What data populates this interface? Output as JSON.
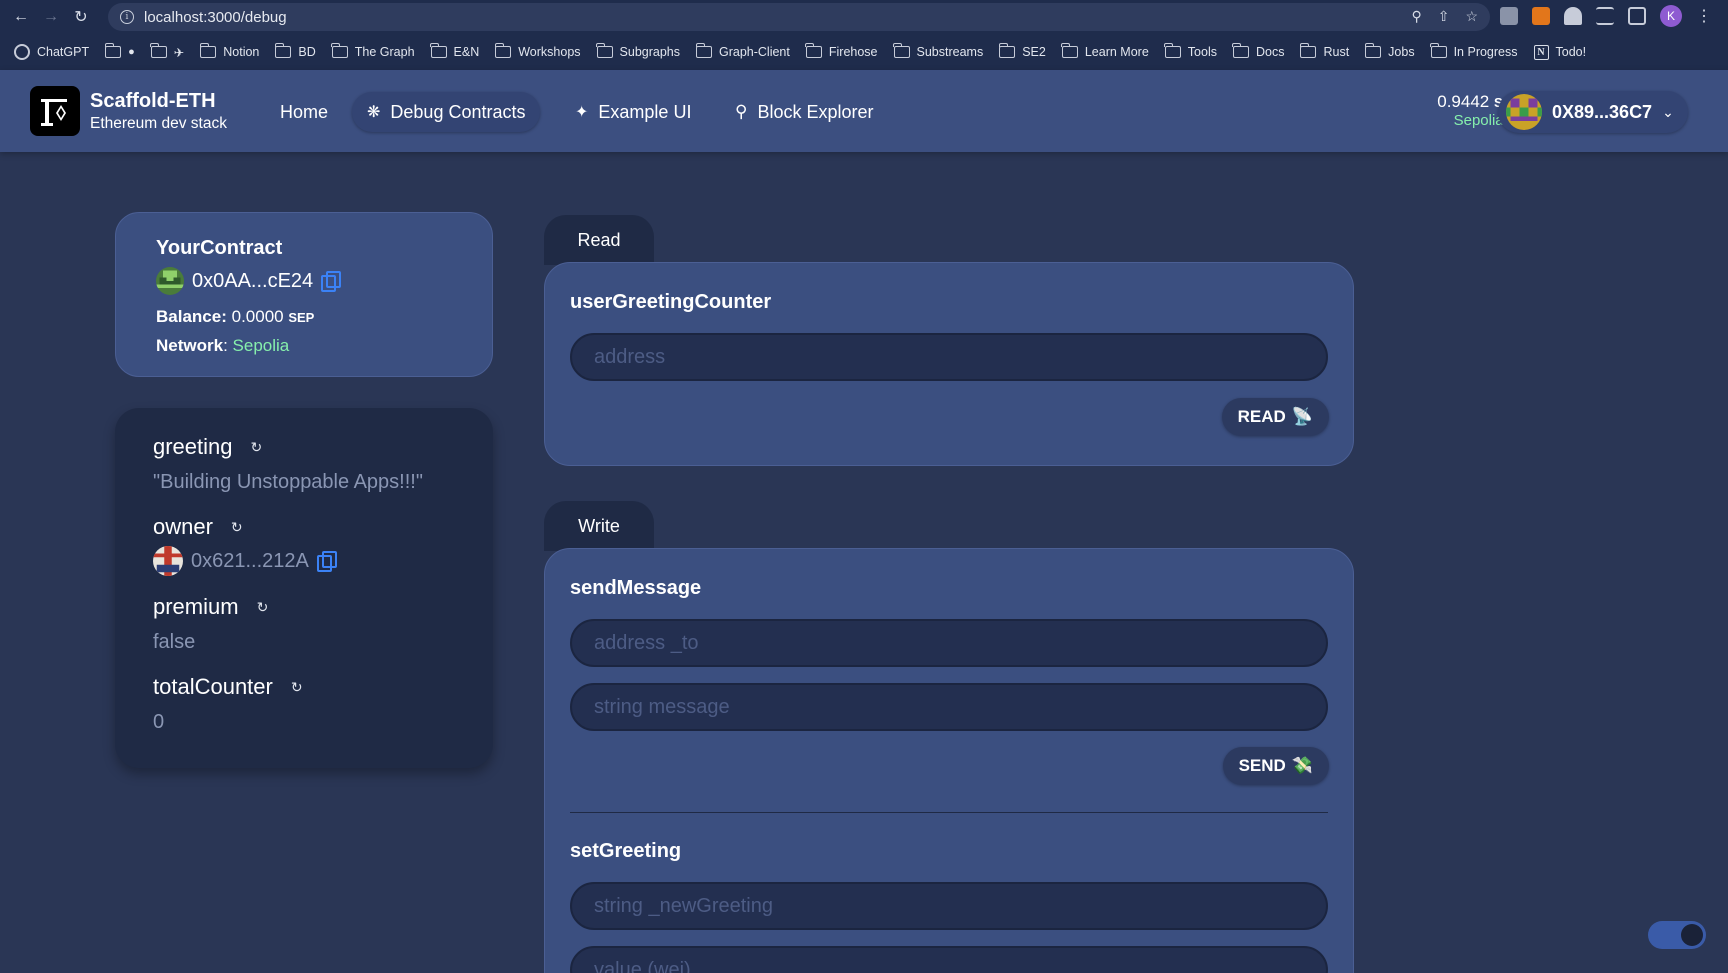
{
  "browser": {
    "url": "localhost:3000/debug",
    "profile_initial": "K",
    "bookmarks": [
      "ChatGPT",
      "",
      "",
      "Notion",
      "BD",
      "The Graph",
      "E&N",
      "Workshops",
      "Subgraphs",
      "Graph-Client",
      "Firehose",
      "Substreams",
      "SE2",
      "Learn More",
      "Tools",
      "Docs",
      "Rust",
      "Jobs",
      "In Progress",
      "Todo!"
    ]
  },
  "header": {
    "brand_title": "Scaffold-ETH",
    "brand_subtitle": "Ethereum dev stack",
    "nav": [
      {
        "label": "Home"
      },
      {
        "label": "Debug Contracts"
      },
      {
        "label": "Example UI"
      },
      {
        "label": "Block Explorer"
      }
    ],
    "balance_amount": "0.9442",
    "balance_unit": "SEP",
    "network": "Sepolia",
    "account_address": "0X89...36C7"
  },
  "contract": {
    "name": "YourContract",
    "address": "0x0AA...cE24",
    "balance_label": "Balance:",
    "balance_value": "0.0000",
    "balance_unit": "SEP",
    "network_label": "Network",
    "network_value": "Sepolia"
  },
  "variables": [
    {
      "name": "greeting",
      "value": "\"Building Unstoppable Apps!!!\""
    },
    {
      "name": "owner",
      "value": "0x621...212A"
    },
    {
      "name": "premium",
      "value": "false"
    },
    {
      "name": "totalCounter",
      "value": "0"
    }
  ],
  "read": {
    "tab": "Read",
    "fn_name": "userGreetingCounter",
    "input_placeholder": "address",
    "button": "READ"
  },
  "write": {
    "tab": "Write",
    "send_message": {
      "fn_name": "sendMessage",
      "input1_placeholder": "address _to",
      "input2_placeholder": "string message",
      "button": "SEND"
    },
    "set_greeting": {
      "fn_name": "setGreeting",
      "input1_placeholder": "string _newGreeting",
      "input2_placeholder": "value (wei)"
    }
  },
  "colors": {
    "background": "#2a3655",
    "header": "#3c4f80",
    "card": "#3b4f80",
    "dark_card": "#1f2a45",
    "accent_green": "#86efac",
    "copy_blue": "#3b82f6"
  }
}
